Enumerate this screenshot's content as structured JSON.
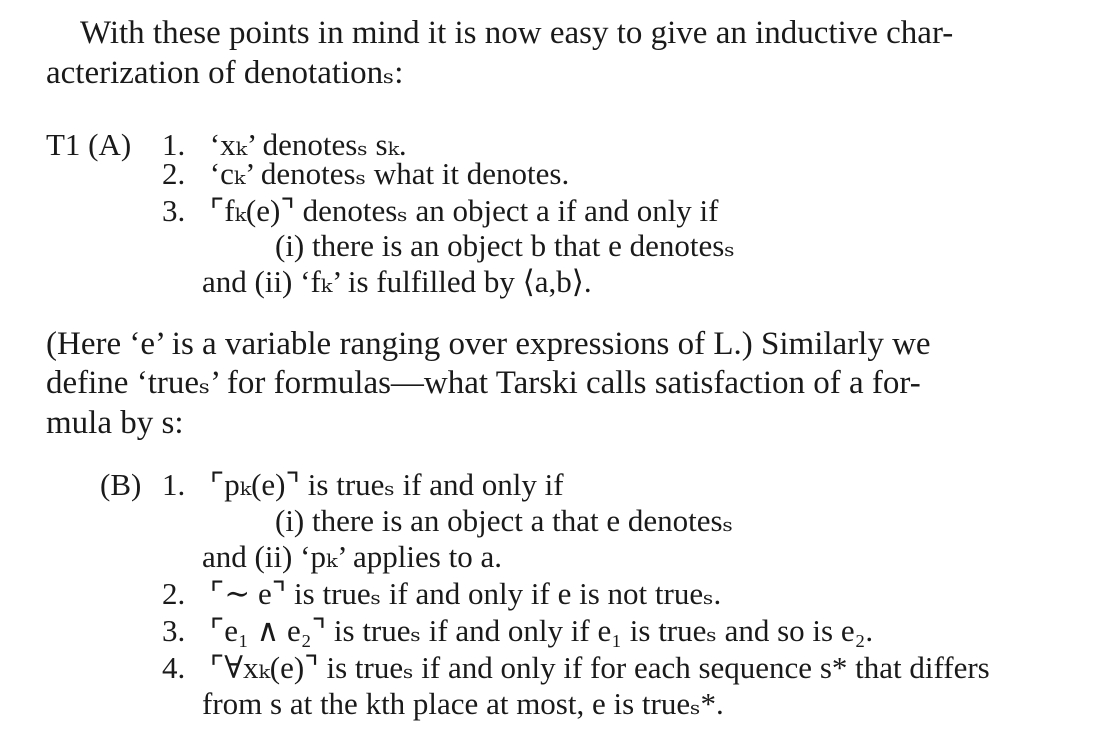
{
  "intro": {
    "line1": "With these points in mind it is now easy to give an inductive char-",
    "line2": "acterization of denotationₛ:"
  },
  "section_a": {
    "label": "T1 (A)",
    "items": [
      {
        "num": "1.",
        "text": "‘xₖ’ denotesₛ sₖ."
      },
      {
        "num": "2.",
        "text": "‘cₖ’ denotesₛ what it denotes."
      },
      {
        "num": "3.",
        "text": "⌜fₖ(e)⌝ denotesₛ an object a if and only if"
      }
    ],
    "sub_i": "(i) there is an object b that e denotesₛ",
    "sub_ii": "and (ii) ‘fₖ’ is fulfilled by ⟨a,b⟩."
  },
  "middle": {
    "line1": "(Here ‘e’ is a variable ranging over expressions of L.) Similarly we",
    "line2": "define ‘trueₛ’ for formulas—what Tarski calls satisfaction of a for-",
    "line3": "mula by s:"
  },
  "section_b": {
    "label": "(B)",
    "items": [
      {
        "num": "1.",
        "text": "⌜pₖ(e)⌝ is trueₛ if and only if"
      },
      {
        "num": "2.",
        "text": "⌜∼ e⌝ is trueₛ if and only if e is not trueₛ."
      },
      {
        "num": "3.",
        "text": "⌜e₁ ∧ e₂⌝ is trueₛ if and only if e₁ is trueₛ and so is e₂."
      },
      {
        "num": "4.",
        "text": "⌜∀xₖ(e)⌝ is trueₛ if and only if for each sequence s* that differs"
      }
    ],
    "sub_i": "(i) there is an object a that e denotesₛ",
    "sub_ii": "and (ii) ‘pₖ’ applies to a.",
    "item4_cont": "from s at the kth place at most, e is trueₛ*."
  }
}
